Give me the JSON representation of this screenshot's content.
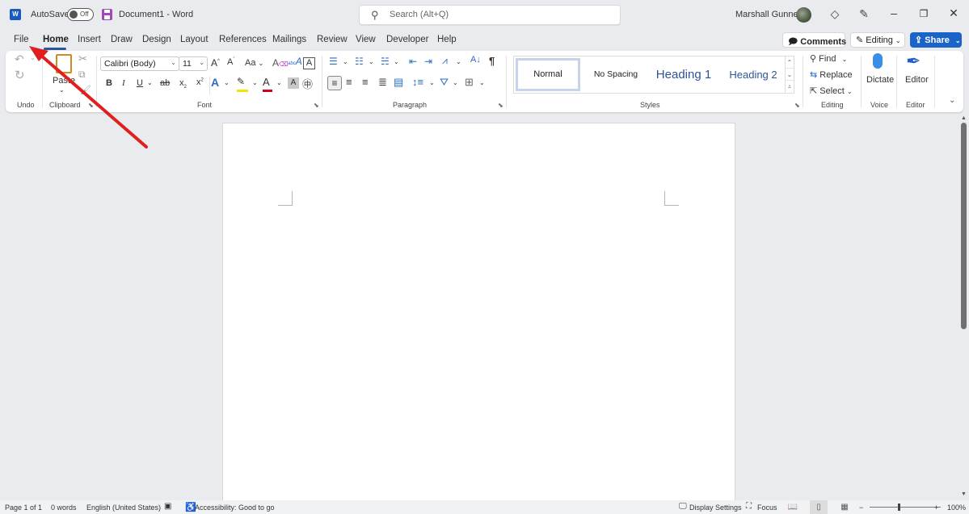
{
  "titlebar": {
    "app_logo": "word-logo-icon",
    "app_logo_letter": "W",
    "autosave_label": "AutoSave",
    "autosave_state": "Off",
    "doc_title": "Document1 - Word",
    "search_placeholder": "Search (Alt+Q)",
    "user_name": "Marshall Gunnell",
    "icons": [
      "diamond-icon",
      "pen-sparkle-icon"
    ],
    "window_controls": [
      "minimize",
      "restore",
      "close"
    ]
  },
  "tabs": [
    {
      "label": "File",
      "active": false
    },
    {
      "label": "Home",
      "active": true
    },
    {
      "label": "Insert",
      "active": false
    },
    {
      "label": "Draw",
      "active": false
    },
    {
      "label": "Design",
      "active": false
    },
    {
      "label": "Layout",
      "active": false
    },
    {
      "label": "References",
      "active": false
    },
    {
      "label": "Mailings",
      "active": false
    },
    {
      "label": "Review",
      "active": false
    },
    {
      "label": "View",
      "active": false
    },
    {
      "label": "Developer",
      "active": false
    },
    {
      "label": "Help",
      "active": false
    }
  ],
  "header_actions": {
    "comments": "Comments",
    "editing": "Editing",
    "share": "Share"
  },
  "ribbon": {
    "groups": {
      "undo": "Undo",
      "clipboard": "Clipboard",
      "font": "Font",
      "paragraph": "Paragraph",
      "styles": "Styles",
      "editing": "Editing",
      "voice": "Voice",
      "editor": "Editor"
    },
    "paste_label": "Paste",
    "font_name": "Calibri (Body)",
    "font_size": "11",
    "change_case": "Aa",
    "styles": [
      "Normal",
      "No Spacing",
      "Heading 1",
      "Heading 2"
    ],
    "find": "Find",
    "replace": "Replace",
    "select": "Select",
    "dictate": "Dictate",
    "editor_btn": "Editor",
    "colors": {
      "highlight": "#f2e600",
      "font_color": "#d0021b",
      "heading": "#2f5496",
      "accent": "#185abd"
    }
  },
  "statusbar": {
    "page": "Page 1 of 1",
    "words": "0 words",
    "language": "English (United States)",
    "accessibility": "Accessibility: Good to go",
    "display_settings": "Display Settings",
    "focus": "Focus",
    "zoom_minus": "−",
    "zoom_plus": "+",
    "zoom_level": "100%",
    "zoom_percent": 100
  },
  "annotation": {
    "type": "arrow",
    "color": "#e02020",
    "points_to": "File tab"
  }
}
